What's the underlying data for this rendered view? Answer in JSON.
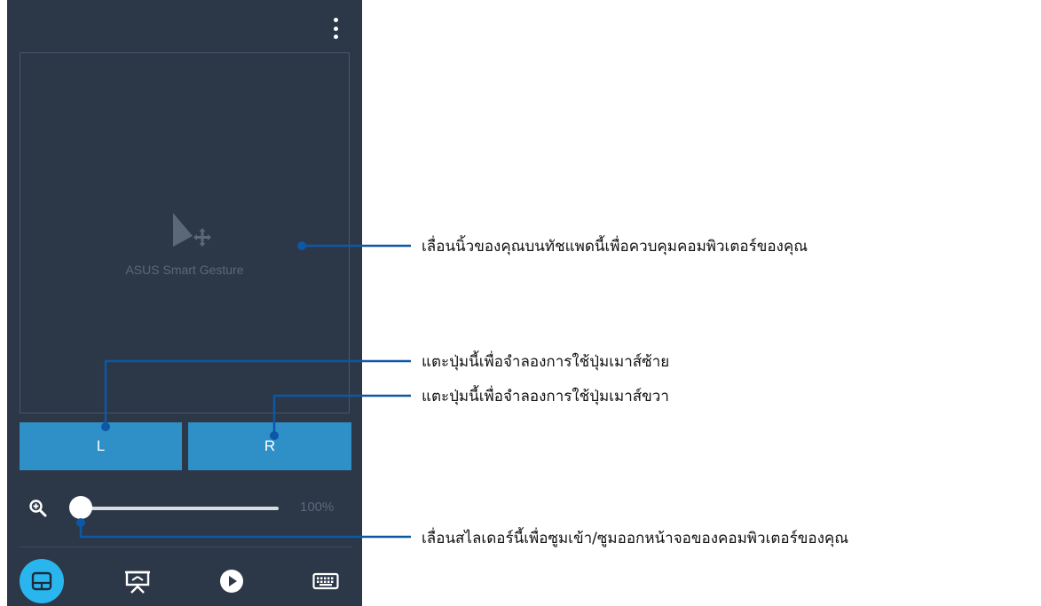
{
  "app": {
    "touchpad_label": "ASUS Smart Gesture",
    "left_button_label": "L",
    "right_button_label": "R",
    "zoom_value": "100%",
    "zoom_level": 0,
    "active_tab": "touchpad"
  },
  "nav": {
    "items": [
      "touchpad",
      "presentation",
      "media",
      "keyboard"
    ]
  },
  "callouts": {
    "touchpad": "เลื่อนนิ้วของคุณบนทัชแพดนี้เพื่อควบคุมคอมพิวเตอร์ของคุณ",
    "left_button": "แตะปุ่มนี้เพื่อจำลองการใช้ปุ่มเมาส์ซ้าย",
    "right_button": "แตะปุ่มนี้เพื่อจำลองการใช้ปุ่มเมาส์ขวา",
    "zoom_slider": "เลื่อนสไลเดอร์นี้เพื่อซูมเข้า/ซูมออกหน้าจอของคอมพิวเตอร์ของคุณ"
  },
  "colors": {
    "background": "#2c3848",
    "button": "#2f8fc7",
    "active_nav": "#29b6ef",
    "callout_line": "#0d57a7"
  }
}
